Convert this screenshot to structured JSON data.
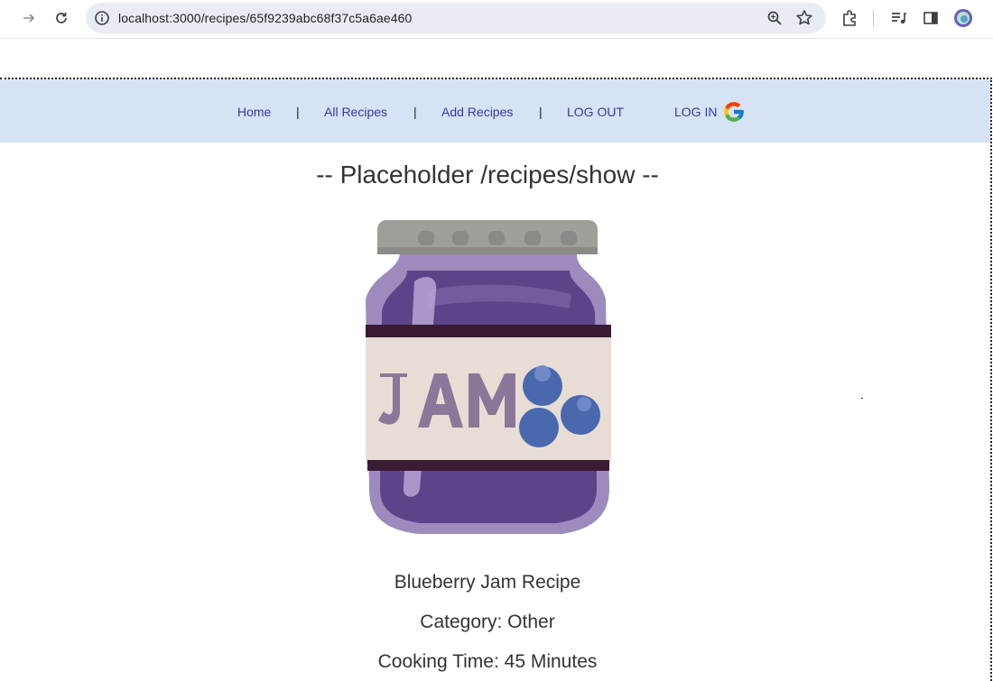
{
  "browser": {
    "url": "localhost:3000/recipes/65f9239abc68f37c5a6ae460",
    "icons": [
      "forward-icon",
      "reload-icon",
      "info-icon",
      "zoom-icon",
      "star-icon",
      "extensions-icon",
      "reading-list-icon",
      "side-panel-icon",
      "profile-icon"
    ]
  },
  "nav": {
    "home": "Home",
    "sep": "|",
    "all_recipes": "All Recipes",
    "add_recipes": "Add Recipes",
    "logout": "LOG OUT",
    "login": "LOG IN"
  },
  "main": {
    "title": "-- Placeholder /recipes/show --",
    "image_alt": "JAM",
    "recipe_name": "Blueberry Jam Recipe",
    "category": "Category: Other",
    "cooking_time": "Cooking Time: 45 Minutes"
  },
  "colors": {
    "navbar_bg": "#d5e3f4",
    "link": "#3a36a8",
    "jar_purple": "#5b4489",
    "blueberry": "#4a68ae"
  }
}
